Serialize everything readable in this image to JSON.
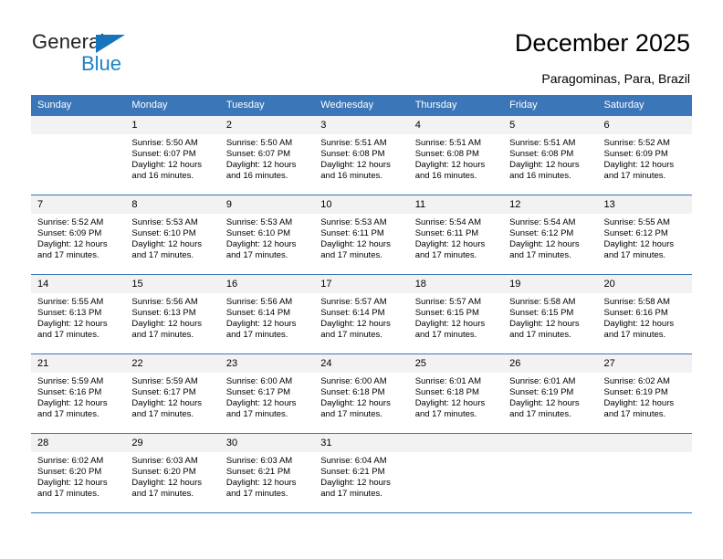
{
  "brand": {
    "name_part1": "General",
    "name_part2": "Blue",
    "logo_icon": "blue-triangle-icon",
    "accent_color": "#1574bb",
    "accent_color_light": "#1c83c6"
  },
  "header": {
    "title": "December 2025",
    "subtitle": "Paragominas, Para, Brazil"
  },
  "calendar": {
    "header_bg": "#3a76b8",
    "daynum_bg": "#f2f2f2",
    "weekday_headers": [
      "Sunday",
      "Monday",
      "Tuesday",
      "Wednesday",
      "Thursday",
      "Friday",
      "Saturday"
    ],
    "weeks": [
      [
        {
          "day": "",
          "sunrise": "",
          "sunset": "",
          "daylight_line1": "",
          "daylight_line2": "",
          "empty": true
        },
        {
          "day": "1",
          "sunrise": "Sunrise: 5:50 AM",
          "sunset": "Sunset: 6:07 PM",
          "daylight_line1": "Daylight: 12 hours",
          "daylight_line2": "and 16 minutes."
        },
        {
          "day": "2",
          "sunrise": "Sunrise: 5:50 AM",
          "sunset": "Sunset: 6:07 PM",
          "daylight_line1": "Daylight: 12 hours",
          "daylight_line2": "and 16 minutes."
        },
        {
          "day": "3",
          "sunrise": "Sunrise: 5:51 AM",
          "sunset": "Sunset: 6:08 PM",
          "daylight_line1": "Daylight: 12 hours",
          "daylight_line2": "and 16 minutes."
        },
        {
          "day": "4",
          "sunrise": "Sunrise: 5:51 AM",
          "sunset": "Sunset: 6:08 PM",
          "daylight_line1": "Daylight: 12 hours",
          "daylight_line2": "and 16 minutes."
        },
        {
          "day": "5",
          "sunrise": "Sunrise: 5:51 AM",
          "sunset": "Sunset: 6:08 PM",
          "daylight_line1": "Daylight: 12 hours",
          "daylight_line2": "and 16 minutes."
        },
        {
          "day": "6",
          "sunrise": "Sunrise: 5:52 AM",
          "sunset": "Sunset: 6:09 PM",
          "daylight_line1": "Daylight: 12 hours",
          "daylight_line2": "and 17 minutes."
        }
      ],
      [
        {
          "day": "7",
          "sunrise": "Sunrise: 5:52 AM",
          "sunset": "Sunset: 6:09 PM",
          "daylight_line1": "Daylight: 12 hours",
          "daylight_line2": "and 17 minutes."
        },
        {
          "day": "8",
          "sunrise": "Sunrise: 5:53 AM",
          "sunset": "Sunset: 6:10 PM",
          "daylight_line1": "Daylight: 12 hours",
          "daylight_line2": "and 17 minutes."
        },
        {
          "day": "9",
          "sunrise": "Sunrise: 5:53 AM",
          "sunset": "Sunset: 6:10 PM",
          "daylight_line1": "Daylight: 12 hours",
          "daylight_line2": "and 17 minutes."
        },
        {
          "day": "10",
          "sunrise": "Sunrise: 5:53 AM",
          "sunset": "Sunset: 6:11 PM",
          "daylight_line1": "Daylight: 12 hours",
          "daylight_line2": "and 17 minutes."
        },
        {
          "day": "11",
          "sunrise": "Sunrise: 5:54 AM",
          "sunset": "Sunset: 6:11 PM",
          "daylight_line1": "Daylight: 12 hours",
          "daylight_line2": "and 17 minutes."
        },
        {
          "day": "12",
          "sunrise": "Sunrise: 5:54 AM",
          "sunset": "Sunset: 6:12 PM",
          "daylight_line1": "Daylight: 12 hours",
          "daylight_line2": "and 17 minutes."
        },
        {
          "day": "13",
          "sunrise": "Sunrise: 5:55 AM",
          "sunset": "Sunset: 6:12 PM",
          "daylight_line1": "Daylight: 12 hours",
          "daylight_line2": "and 17 minutes."
        }
      ],
      [
        {
          "day": "14",
          "sunrise": "Sunrise: 5:55 AM",
          "sunset": "Sunset: 6:13 PM",
          "daylight_line1": "Daylight: 12 hours",
          "daylight_line2": "and 17 minutes."
        },
        {
          "day": "15",
          "sunrise": "Sunrise: 5:56 AM",
          "sunset": "Sunset: 6:13 PM",
          "daylight_line1": "Daylight: 12 hours",
          "daylight_line2": "and 17 minutes."
        },
        {
          "day": "16",
          "sunrise": "Sunrise: 5:56 AM",
          "sunset": "Sunset: 6:14 PM",
          "daylight_line1": "Daylight: 12 hours",
          "daylight_line2": "and 17 minutes."
        },
        {
          "day": "17",
          "sunrise": "Sunrise: 5:57 AM",
          "sunset": "Sunset: 6:14 PM",
          "daylight_line1": "Daylight: 12 hours",
          "daylight_line2": "and 17 minutes."
        },
        {
          "day": "18",
          "sunrise": "Sunrise: 5:57 AM",
          "sunset": "Sunset: 6:15 PM",
          "daylight_line1": "Daylight: 12 hours",
          "daylight_line2": "and 17 minutes."
        },
        {
          "day": "19",
          "sunrise": "Sunrise: 5:58 AM",
          "sunset": "Sunset: 6:15 PM",
          "daylight_line1": "Daylight: 12 hours",
          "daylight_line2": "and 17 minutes."
        },
        {
          "day": "20",
          "sunrise": "Sunrise: 5:58 AM",
          "sunset": "Sunset: 6:16 PM",
          "daylight_line1": "Daylight: 12 hours",
          "daylight_line2": "and 17 minutes."
        }
      ],
      [
        {
          "day": "21",
          "sunrise": "Sunrise: 5:59 AM",
          "sunset": "Sunset: 6:16 PM",
          "daylight_line1": "Daylight: 12 hours",
          "daylight_line2": "and 17 minutes."
        },
        {
          "day": "22",
          "sunrise": "Sunrise: 5:59 AM",
          "sunset": "Sunset: 6:17 PM",
          "daylight_line1": "Daylight: 12 hours",
          "daylight_line2": "and 17 minutes."
        },
        {
          "day": "23",
          "sunrise": "Sunrise: 6:00 AM",
          "sunset": "Sunset: 6:17 PM",
          "daylight_line1": "Daylight: 12 hours",
          "daylight_line2": "and 17 minutes."
        },
        {
          "day": "24",
          "sunrise": "Sunrise: 6:00 AM",
          "sunset": "Sunset: 6:18 PM",
          "daylight_line1": "Daylight: 12 hours",
          "daylight_line2": "and 17 minutes."
        },
        {
          "day": "25",
          "sunrise": "Sunrise: 6:01 AM",
          "sunset": "Sunset: 6:18 PM",
          "daylight_line1": "Daylight: 12 hours",
          "daylight_line2": "and 17 minutes."
        },
        {
          "day": "26",
          "sunrise": "Sunrise: 6:01 AM",
          "sunset": "Sunset: 6:19 PM",
          "daylight_line1": "Daylight: 12 hours",
          "daylight_line2": "and 17 minutes."
        },
        {
          "day": "27",
          "sunrise": "Sunrise: 6:02 AM",
          "sunset": "Sunset: 6:19 PM",
          "daylight_line1": "Daylight: 12 hours",
          "daylight_line2": "and 17 minutes."
        }
      ],
      [
        {
          "day": "28",
          "sunrise": "Sunrise: 6:02 AM",
          "sunset": "Sunset: 6:20 PM",
          "daylight_line1": "Daylight: 12 hours",
          "daylight_line2": "and 17 minutes."
        },
        {
          "day": "29",
          "sunrise": "Sunrise: 6:03 AM",
          "sunset": "Sunset: 6:20 PM",
          "daylight_line1": "Daylight: 12 hours",
          "daylight_line2": "and 17 minutes."
        },
        {
          "day": "30",
          "sunrise": "Sunrise: 6:03 AM",
          "sunset": "Sunset: 6:21 PM",
          "daylight_line1": "Daylight: 12 hours",
          "daylight_line2": "and 17 minutes."
        },
        {
          "day": "31",
          "sunrise": "Sunrise: 6:04 AM",
          "sunset": "Sunset: 6:21 PM",
          "daylight_line1": "Daylight: 12 hours",
          "daylight_line2": "and 17 minutes."
        },
        {
          "day": "",
          "sunrise": "",
          "sunset": "",
          "daylight_line1": "",
          "daylight_line2": "",
          "empty": true
        },
        {
          "day": "",
          "sunrise": "",
          "sunset": "",
          "daylight_line1": "",
          "daylight_line2": "",
          "empty": true
        },
        {
          "day": "",
          "sunrise": "",
          "sunset": "",
          "daylight_line1": "",
          "daylight_line2": "",
          "empty": true
        }
      ]
    ]
  }
}
